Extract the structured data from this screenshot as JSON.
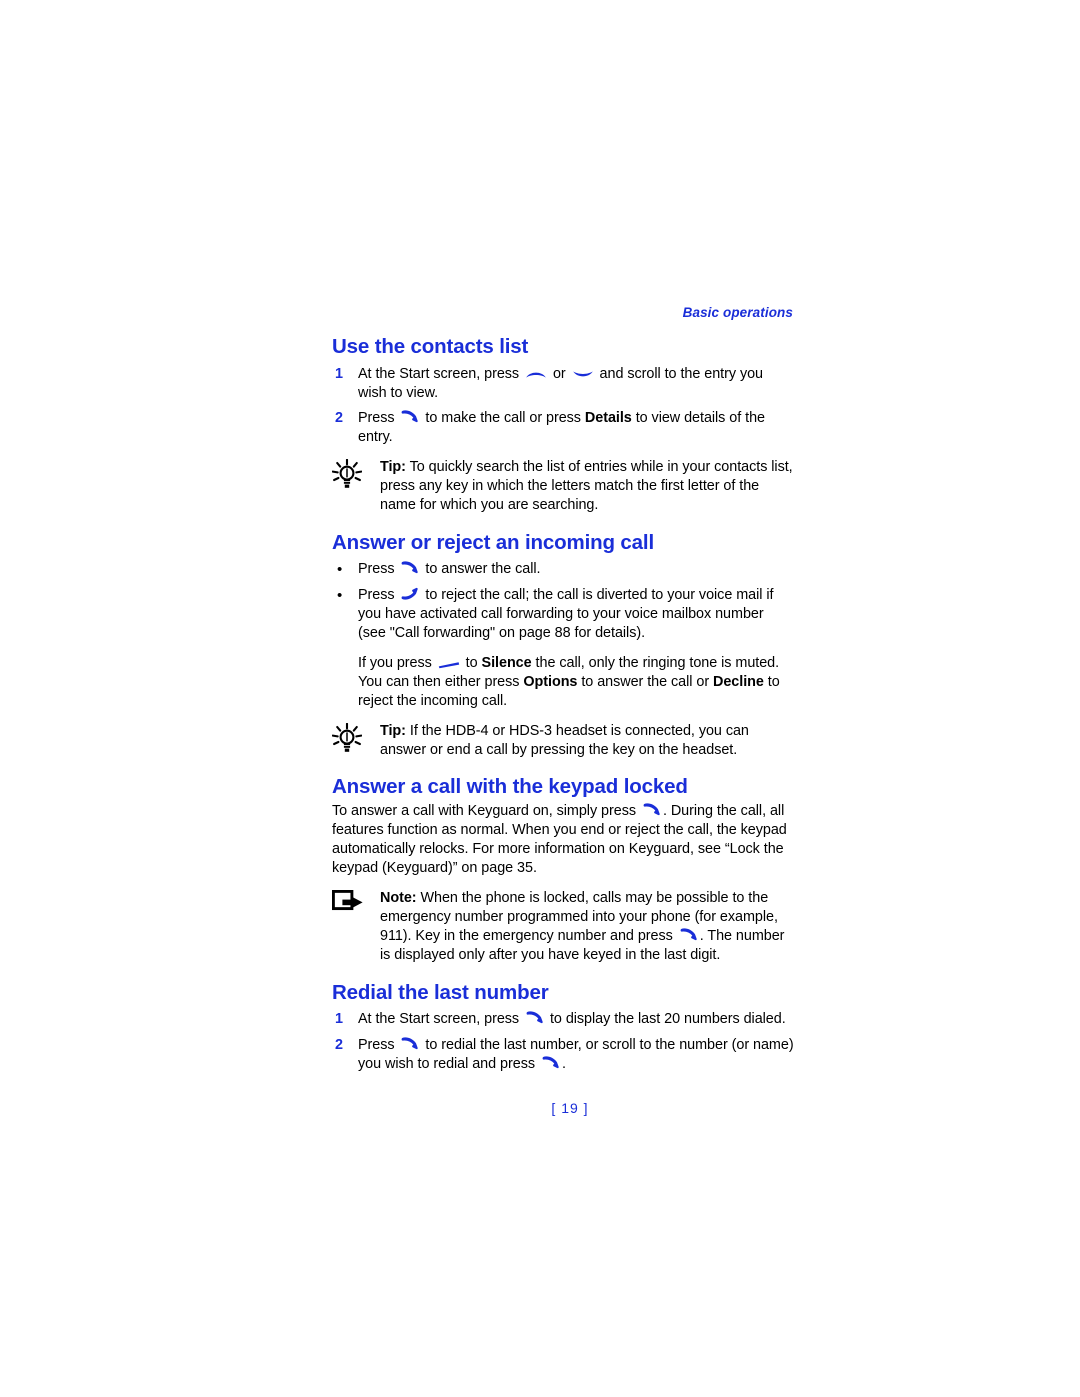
{
  "colors": {
    "accent_blue": "#1a2ed8",
    "body_black": "#000000",
    "page_background": "#ffffff"
  },
  "running_header": "Basic operations",
  "page_number": "[ 19 ]",
  "sections": [
    {
      "heading": "Use the contacts list",
      "steps": [
        {
          "marker": "1",
          "parts": [
            {
              "t": "text",
              "v": "At the Start screen, press "
            },
            {
              "t": "icon",
              "v": "scroll-up-key-icon"
            },
            {
              "t": "text",
              "v": " or "
            },
            {
              "t": "icon",
              "v": "scroll-down-key-icon"
            },
            {
              "t": "text",
              "v": " and scroll to the entry you wish to view."
            }
          ]
        },
        {
          "marker": "2",
          "parts": [
            {
              "t": "text",
              "v": "Press "
            },
            {
              "t": "icon",
              "v": "call-key-icon"
            },
            {
              "t": "text",
              "v": " to make the call or press "
            },
            {
              "t": "bold",
              "v": "Details"
            },
            {
              "t": "text",
              "v": " to view details of the entry."
            }
          ]
        }
      ],
      "callout": {
        "kind": "tip",
        "icon": "lightbulb-tip-icon",
        "label": "Tip:",
        "text": " To quickly search the list of entries while in your contacts list, press any key in which the letters match the first letter of the name for which you are searching."
      }
    },
    {
      "heading": "Answer or reject an incoming call",
      "bullets": [
        {
          "marker": "•",
          "parts": [
            {
              "t": "text",
              "v": "Press "
            },
            {
              "t": "icon",
              "v": "call-key-icon"
            },
            {
              "t": "text",
              "v": " to answer the call."
            }
          ]
        },
        {
          "marker": "•",
          "parts": [
            {
              "t": "text",
              "v": "Press "
            },
            {
              "t": "icon",
              "v": "end-key-icon"
            },
            {
              "t": "text",
              "v": " to reject the call; the call is diverted to your voice mail if you have activated call forwarding to your voice mailbox number (see \"Call forwarding\" on page 88 for details)."
            }
          ]
        }
      ],
      "subparagraph": [
        {
          "t": "text",
          "v": "If you press "
        },
        {
          "t": "icon",
          "v": "selection-key-icon"
        },
        {
          "t": "text",
          "v": " to "
        },
        {
          "t": "bold",
          "v": "Silence"
        },
        {
          "t": "text",
          "v": " the call, only the ringing tone is muted. You can then either press "
        },
        {
          "t": "bold",
          "v": "Options"
        },
        {
          "t": "text",
          "v": " to answer the call or "
        },
        {
          "t": "bold",
          "v": "Decline"
        },
        {
          "t": "text",
          "v": " to reject the incoming call."
        }
      ],
      "callout": {
        "kind": "tip",
        "icon": "lightbulb-tip-icon",
        "label": "Tip:",
        "text": " If the HDB-4 or HDS-3 headset is connected, you can answer or end a call by pressing the key on the headset."
      }
    },
    {
      "heading": "Answer a call with the keypad locked",
      "paragraph": [
        {
          "t": "text",
          "v": "To answer a call with Keyguard on, simply press "
        },
        {
          "t": "icon",
          "v": "call-key-icon"
        },
        {
          "t": "text",
          "v": ". During the call, all features function as normal. When you end or reject the call, the keypad automatically relocks. For more information on Keyguard, see “Lock the keypad (Keyguard)” on page 35."
        }
      ],
      "callout": {
        "kind": "note",
        "icon": "note-arrow-icon",
        "label": "Note:",
        "parts": [
          {
            "t": "text",
            "v": " When the phone is locked, calls may be possible to the emergency number programmed into your phone (for example, 911). Key in the emergency number and press "
          },
          {
            "t": "icon",
            "v": "call-key-icon"
          },
          {
            "t": "text",
            "v": ". The number is displayed only after you have keyed in the last digit."
          }
        ]
      }
    },
    {
      "heading": "Redial the last number",
      "steps": [
        {
          "marker": "1",
          "parts": [
            {
              "t": "text",
              "v": "At the Start screen, press "
            },
            {
              "t": "icon",
              "v": "call-key-icon"
            },
            {
              "t": "text",
              "v": " to display the last 20 numbers dialed."
            }
          ]
        },
        {
          "marker": "2",
          "parts": [
            {
              "t": "text",
              "v": "Press "
            },
            {
              "t": "icon",
              "v": "call-key-icon"
            },
            {
              "t": "text",
              "v": " to redial the last number, or scroll to the number (or name) you wish to redial and press "
            },
            {
              "t": "icon",
              "v": "call-key-icon"
            },
            {
              "t": "text",
              "v": "."
            }
          ]
        }
      ]
    }
  ]
}
